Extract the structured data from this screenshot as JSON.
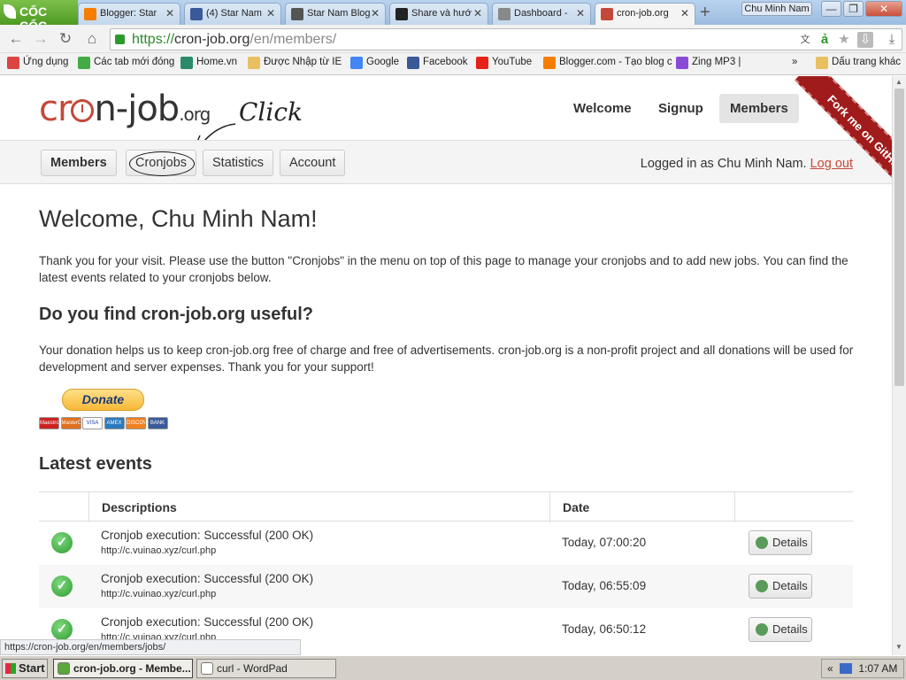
{
  "browser": {
    "brand": "CỐC CỐC",
    "tabs": [
      {
        "title": "Blogger: Star",
        "icon": "blogger-icon",
        "color": "#f57d00"
      },
      {
        "title": "(4) Star Nam",
        "icon": "facebook-icon",
        "color": "#3b5998"
      },
      {
        "title": "Star Nam Blog",
        "icon": "wordpress-icon",
        "color": "#555555"
      },
      {
        "title": "Share và hướ",
        "icon": "page-icon",
        "color": "#222222"
      },
      {
        "title": "Dashboard - ",
        "icon": "document-icon",
        "color": "#888888"
      },
      {
        "title": "cron-job.org",
        "icon": "cronjob-icon",
        "color": "#c4483a",
        "active": true
      }
    ],
    "user": "Chu Minh Nam",
    "window_buttons": [
      "—",
      "❐",
      "✕"
    ],
    "url_scheme": "https://",
    "url_host": "cron-job.org",
    "url_path": "/en/members/",
    "bookmarks": [
      {
        "label": "Ứng dụng",
        "icon": "apps-icon",
        "color": "#d44"
      },
      {
        "label": "Các tab mới đóng",
        "icon": "recent-tabs-icon",
        "color": "#4a4"
      },
      {
        "label": "Home.vn",
        "icon": "home-vn-icon",
        "color": "#2a8a6a"
      },
      {
        "label": "Được Nhập từ IE",
        "icon": "folder-icon",
        "color": "#e8c060"
      },
      {
        "label": "Google",
        "icon": "google-icon",
        "color": "#4285f4"
      },
      {
        "label": "Facebook",
        "icon": "facebook-icon",
        "color": "#3b5998"
      },
      {
        "label": "YouTube",
        "icon": "youtube-icon",
        "color": "#e62117"
      },
      {
        "label": "Blogger.com - Tạo blog c",
        "icon": "blogger-icon",
        "color": "#f57d00"
      },
      {
        "label": "Zing MP3 |",
        "icon": "zing-icon",
        "color": "#8a4ad8"
      }
    ],
    "bookmarks_overflow": "»",
    "other_bookmarks": "Dấu trang khác",
    "status_url": "https://cron-job.org/en/members/jobs/"
  },
  "site": {
    "logo_prefix": "cr",
    "logo_suffix": "n-job",
    "logo_tld": ".org",
    "annotation": "Click",
    "topnav": [
      "Welcome",
      "Signup",
      "Members"
    ],
    "topnav_active": "Members",
    "subnav": [
      "Members",
      "Cronjobs",
      "Statistics",
      "Account"
    ],
    "logged_in_prefix": "Logged in as Chu Minh Nam.",
    "logout": "Log out",
    "ribbon": "Fork me on GitHub"
  },
  "main": {
    "welcome": "Welcome, Chu Minh Nam!",
    "intro": "Thank you for your visit. Please use the button \"Cronjobs\" in the menu on top of this page to manage your cronjobs and to add new jobs. You can find the latest events related to your cronjobs below.",
    "useful_heading": "Do you find cron-job.org useful?",
    "donation_text": "Your donation helps us to keep cron-job.org free of charge and free of advertisements. cron-job.org is a non-profit project and all donations will be used for development and server expenses. Thank you for your support!",
    "donate_button": "Donate",
    "payment_cards": [
      {
        "label": "Maestro",
        "color": "#cc2222"
      },
      {
        "label": "MasterCard",
        "color": "#e07020"
      },
      {
        "label": "VISA",
        "color": "#ffffff"
      },
      {
        "label": "AMEX",
        "color": "#2a7ac0"
      },
      {
        "label": "DISCOVER",
        "color": "#f08020"
      },
      {
        "label": "BANK",
        "color": "#3a5a9a"
      }
    ],
    "events_heading": "Latest events",
    "events_columns": [
      "Descriptions",
      "Date"
    ],
    "events": [
      {
        "status": "Cronjob execution: Successful (200 OK)",
        "url": "http://c.vuinao.xyz/curl.php",
        "date": "Today, 07:00:20",
        "action": "Details"
      },
      {
        "status": "Cronjob execution: Successful (200 OK)",
        "url": "http://c.vuinao.xyz/curl.php",
        "date": "Today, 06:55:09",
        "action": "Details"
      },
      {
        "status": "Cronjob execution: Successful (200 OK)",
        "url": "http://c.vuinao.xyz/curl.php",
        "date": "Today, 06:50:12",
        "action": "Details"
      }
    ]
  },
  "taskbar": {
    "start": "Start",
    "tasks": [
      {
        "label": "cron-job.org - Membe...",
        "icon": "coccoc-icon",
        "color": "#5aa83a",
        "active": true
      },
      {
        "label": "curl - WordPad",
        "icon": "wordpad-icon",
        "color": "#ffffff"
      }
    ],
    "tray_chevron": "«",
    "time": "1:07 AM"
  }
}
